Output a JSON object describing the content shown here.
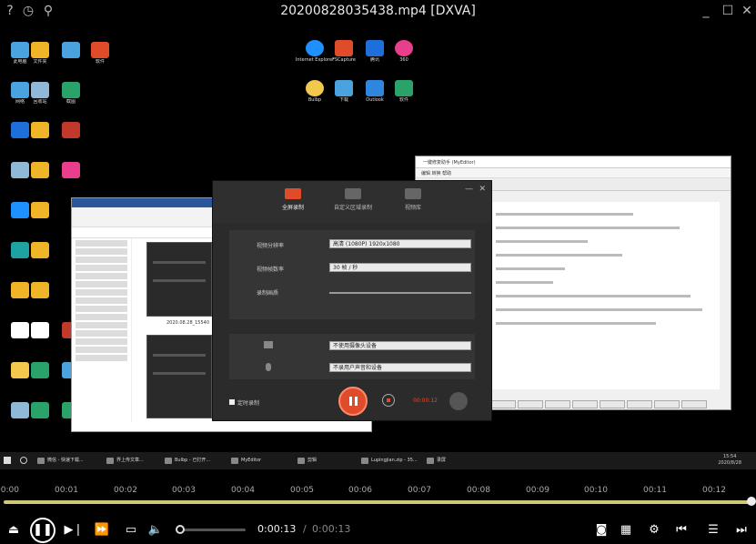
{
  "window": {
    "title": "20200828035438.mp4 [DXVA]"
  },
  "desktop": {
    "icons": [
      {
        "label": "此电脑",
        "color": "#4aa3df"
      },
      {
        "label": "文件夹",
        "color": "#f0b429"
      },
      {
        "label": "网络",
        "color": "#4aa3df"
      },
      {
        "label": "回收站",
        "color": "#8fb9d6"
      },
      {
        "label": "软件",
        "color": "#e04b2a"
      },
      {
        "label": "截图",
        "color": "#29a36a"
      },
      {
        "label": "Internet Explorer",
        "color": "#1e90ff"
      },
      {
        "label": "FSCapture",
        "color": "#e04b2a"
      },
      {
        "label": "腾讯",
        "color": "#1e6fd9"
      },
      {
        "label": "360",
        "color": "#e83e8c"
      },
      {
        "label": "Bulbp",
        "color": "#f2c94c"
      },
      {
        "label": "下载",
        "color": "#4aa3df"
      },
      {
        "label": "Outlook",
        "color": "#2e86de"
      },
      {
        "label": "软件",
        "color": "#29a36a"
      }
    ]
  },
  "recorder": {
    "tabs": [
      {
        "label": "全屏录制",
        "active": true
      },
      {
        "label": "自定义区域录制",
        "active": false
      },
      {
        "label": "视频库",
        "active": false
      }
    ],
    "rows": [
      {
        "label": "视频分辨率",
        "value": "高清 (1080P)  1920x1080"
      },
      {
        "label": "视频帧数率",
        "value": "30 帧 / 秒"
      },
      {
        "label": "录制画质",
        "value": ""
      }
    ],
    "audio": [
      {
        "value": "不使用摄像头设备"
      },
      {
        "value": "不录用户声音和设备"
      }
    ],
    "checkbox_label": "定时录制",
    "timer": "00:00:12"
  },
  "editor": {
    "title": "一键修复助手 (MyEditor)",
    "menu": "编辑 转换 帮助"
  },
  "explorer": {
    "caption": "2020.08.28_15540"
  },
  "taskbar": {
    "items": [
      {
        "label": "微信 - 快速下载..."
      },
      {
        "label": "界上传文章..."
      },
      {
        "label": "Bulbp - 已打开..."
      },
      {
        "label": "MyEditor"
      },
      {
        "label": "剪辑"
      },
      {
        "label": "Lupingjian.zip - 35..."
      },
      {
        "label": "录屏"
      }
    ],
    "clock_time": "15:54",
    "clock_date": "2020/8/28"
  },
  "timeline": {
    "ticks": [
      "00:00",
      "00:01",
      "00:02",
      "00:03",
      "00:04",
      "00:05",
      "00:06",
      "00:07",
      "00:08",
      "00:09",
      "00:10",
      "00:11",
      "00:12"
    ],
    "progress": 1.0
  },
  "controls": {
    "current_time": "0:00:13",
    "separator": "/",
    "total_time": "0:00:13",
    "volume_level": 0.0
  },
  "colors": {
    "accent": "#cfc87a",
    "record": "#e04b2a"
  }
}
